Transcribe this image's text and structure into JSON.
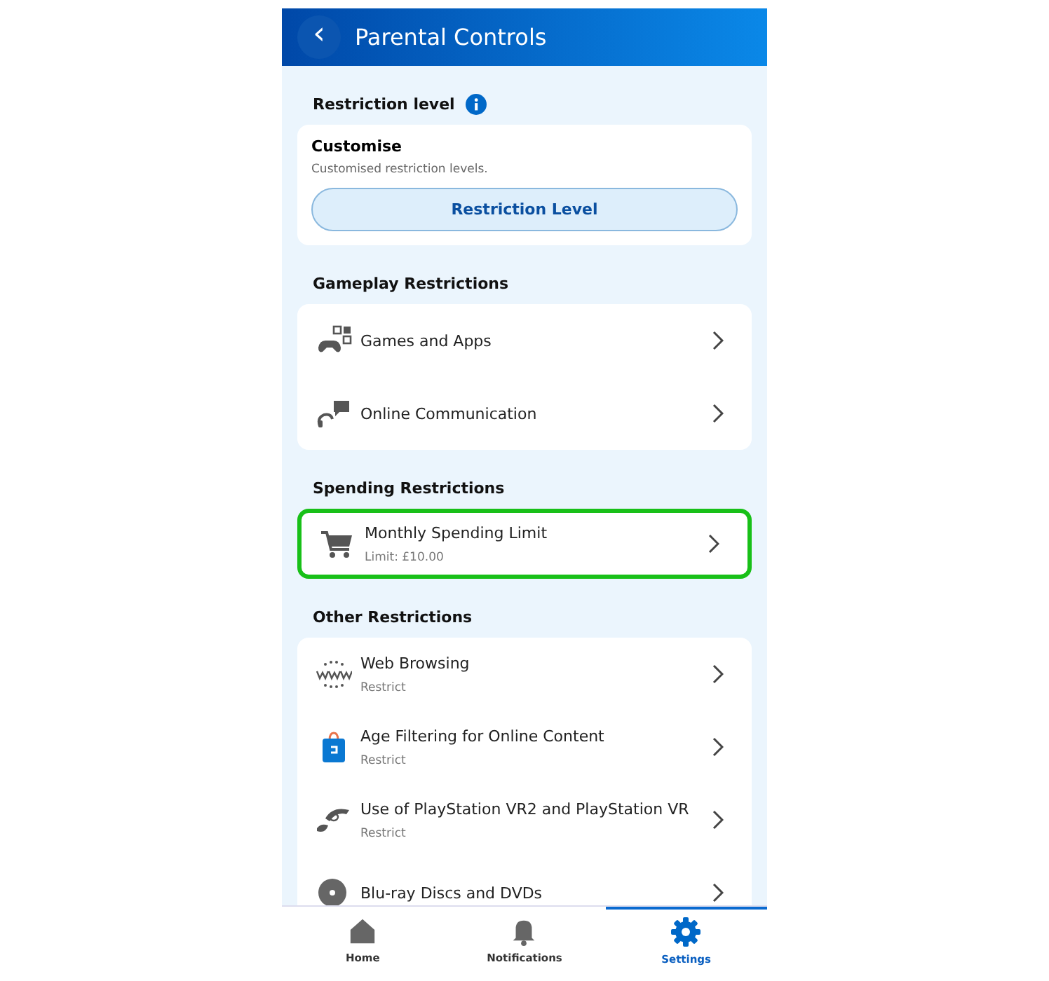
{
  "header": {
    "back": "‹",
    "title": "Parental Controls"
  },
  "restriction": {
    "title": "Restriction level",
    "card_title": "Customise",
    "card_text": "Customised restriction levels.",
    "button": "Restriction Level"
  },
  "sections": [
    {
      "title": "Gameplay Restrictions",
      "highlighted": false,
      "items": [
        {
          "label": "Games and Apps"
        },
        {
          "label": "Online Communication"
        }
      ]
    },
    {
      "title": "Spending Restrictions",
      "highlighted": true,
      "items": [
        {
          "label": "Monthly Spending Limit",
          "sub": "Limit: £10.00"
        }
      ]
    },
    {
      "title": "Other Restrictions",
      "highlighted": false,
      "items": [
        {
          "label": "Web Browsing",
          "sub": "Restrict"
        },
        {
          "label": "Age Filtering for Online Content",
          "sub": "Restrict"
        },
        {
          "label": "Use of PlayStation VR2 and PlayStation VR",
          "sub": "Restrict"
        },
        {
          "label": "Blu-ray Discs and DVDs"
        }
      ]
    }
  ],
  "nav": [
    {
      "label": "Home",
      "selected": false
    },
    {
      "label": "Notifications",
      "selected": false
    },
    {
      "label": "Settings",
      "selected": true
    }
  ]
}
